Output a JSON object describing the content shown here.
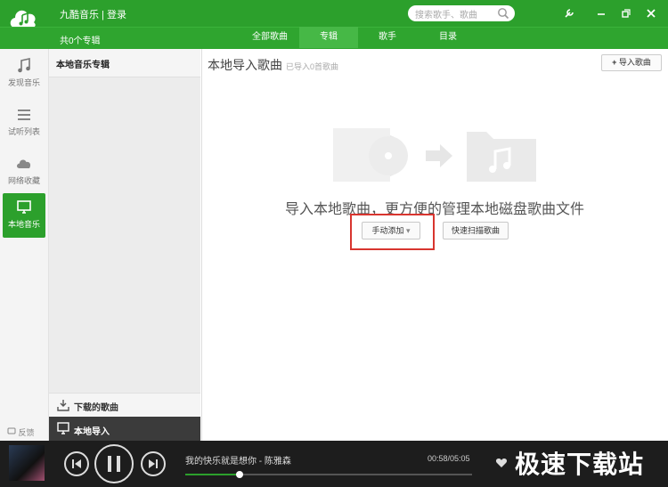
{
  "app": {
    "brand": "九酷音乐",
    "separator": "|",
    "login": "登录",
    "search_placeholder": "搜索歌手、歌曲",
    "album_count": "共0个专辑"
  },
  "tabs": [
    {
      "label": "全部歌曲",
      "active": false
    },
    {
      "label": "专辑",
      "active": true
    },
    {
      "label": "歌手",
      "active": false
    },
    {
      "label": "目录",
      "active": false
    }
  ],
  "rail": [
    {
      "label": "发现音乐",
      "icon": "music-note-icon"
    },
    {
      "label": "试听列表",
      "icon": "list-icon"
    },
    {
      "label": "网络收藏",
      "icon": "cloud-icon"
    },
    {
      "label": "本地音乐",
      "icon": "monitor-icon",
      "active": true
    }
  ],
  "feedback": "反馈",
  "album_panel": {
    "header": "本地音乐专辑",
    "downloaded": "下载的歌曲",
    "local_import": "本地导入"
  },
  "main": {
    "title": "本地导入歌曲",
    "subtitle": "已导入0首歌曲",
    "import_button": "导入歌曲",
    "message": "导入本地歌曲，更方便的管理本地磁盘歌曲文件",
    "manual_add": "手动添加",
    "quick_scan": "快速扫描歌曲"
  },
  "player": {
    "song": "我的快乐就是想你 - 陈雅森",
    "time": "00:58/05:05",
    "progress": 0.19
  },
  "watermark": "极速下载站",
  "colors": {
    "brand_green": "#2ca02c",
    "highlight_red": "#d8352f"
  }
}
